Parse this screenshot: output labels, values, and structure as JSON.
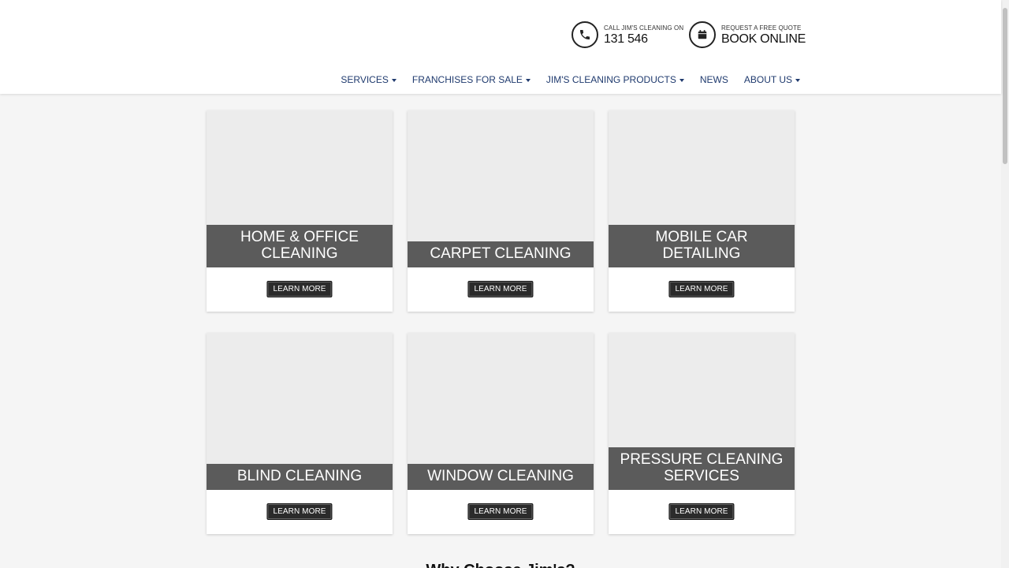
{
  "header": {
    "call": {
      "small": "CALL JIM'S CLEANING ON",
      "big": "131 546",
      "icon": "phone-icon"
    },
    "book": {
      "small": "REQUEST A FREE QUOTE",
      "big": "BOOK ONLINE",
      "icon": "calendar-icon"
    }
  },
  "nav": [
    {
      "label": "SERVICES",
      "dropdown": true
    },
    {
      "label": "FRANCHISES FOR SALE",
      "dropdown": true
    },
    {
      "label": "JIM'S CLEANING PRODUCTS",
      "dropdown": true
    },
    {
      "label": "NEWS",
      "dropdown": false
    },
    {
      "label": "ABOUT US",
      "dropdown": true
    }
  ],
  "cards": [
    {
      "title": "HOME & OFFICE CLEANING",
      "button": "LEARN MORE"
    },
    {
      "title": "CARPET CLEANING",
      "button": "LEARN MORE"
    },
    {
      "title": "MOBILE CAR DETAILING",
      "button": "LEARN MORE"
    },
    {
      "title": "BLIND CLEANING",
      "button": "LEARN MORE"
    },
    {
      "title": "WINDOW CLEANING",
      "button": "LEARN MORE"
    },
    {
      "title": "PRESSURE CLEANING SERVICES",
      "button": "LEARN MORE"
    }
  ],
  "bottom_heading": "Why Choose Jim's?",
  "colors": {
    "nav_text": "#1f3a6e",
    "label_bg": "#5b5b5b",
    "button_bg": "#2b2b2b",
    "image_placeholder": "#ececec"
  }
}
